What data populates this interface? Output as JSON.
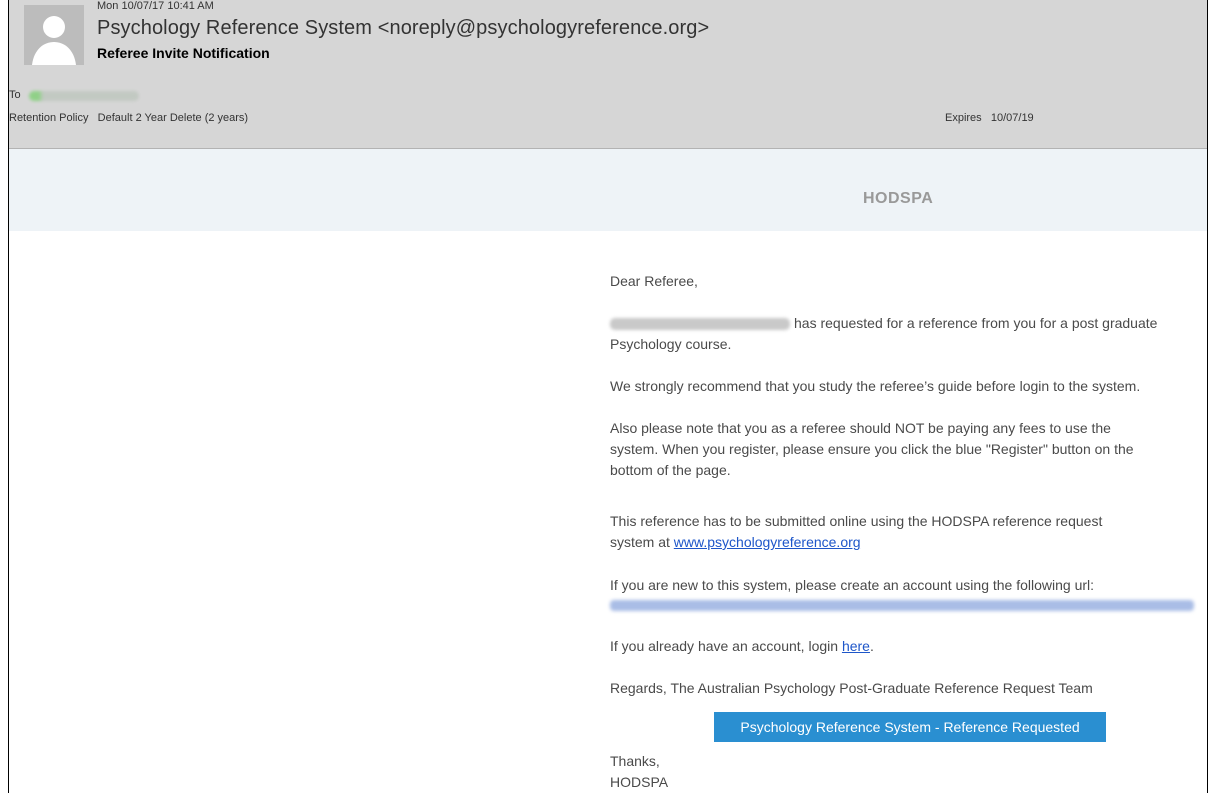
{
  "header": {
    "date": "Mon 10/07/17 10:41 AM",
    "from": "Psychology Reference System <noreply@psychologyreference.org>",
    "subject": "Referee Invite Notification",
    "to_label": "To",
    "retention_label": "Retention Policy",
    "retention_value": "Default 2 Year Delete (2 years)",
    "expires_label": "Expires",
    "expires_value": "10/07/19"
  },
  "email": {
    "brand": "HODSPA",
    "greeting": "Dear Referee,",
    "requested_text": "has requested for a reference from you for a post graduate",
    "requested_text_2": "Psychology course.",
    "recommend": "We strongly recommend that you study the referee’s guide before login to the system.",
    "fees_1": "Also please note that you as a referee should NOT be paying any fees to use the",
    "fees_2": "system. When you register, please ensure you click the blue \"Register\" button on the",
    "fees_3": "bottom of the page.",
    "submit_1": "This reference has to be submitted online using the HODSPA reference request",
    "submit_2_prefix": "system at",
    "submit_link": "www.psychologyreference.org",
    "new_user": "If you are new to this system, please create an account using the following url:",
    "login_prefix": "If you already have an account, login",
    "login_link": "here",
    "login_suffix": ".",
    "regards": "Regards, The Australian Psychology Post-Graduate Reference Request Team",
    "cta_label": "Psychology Reference System - Reference Requested",
    "thanks": "Thanks,",
    "signature": "HODSPA"
  },
  "colors": {
    "header_bg": "#d6d6d6",
    "brand_bar_bg": "#eef3f7",
    "cta_bg": "#2a8fd1",
    "link": "#1e56c9"
  }
}
